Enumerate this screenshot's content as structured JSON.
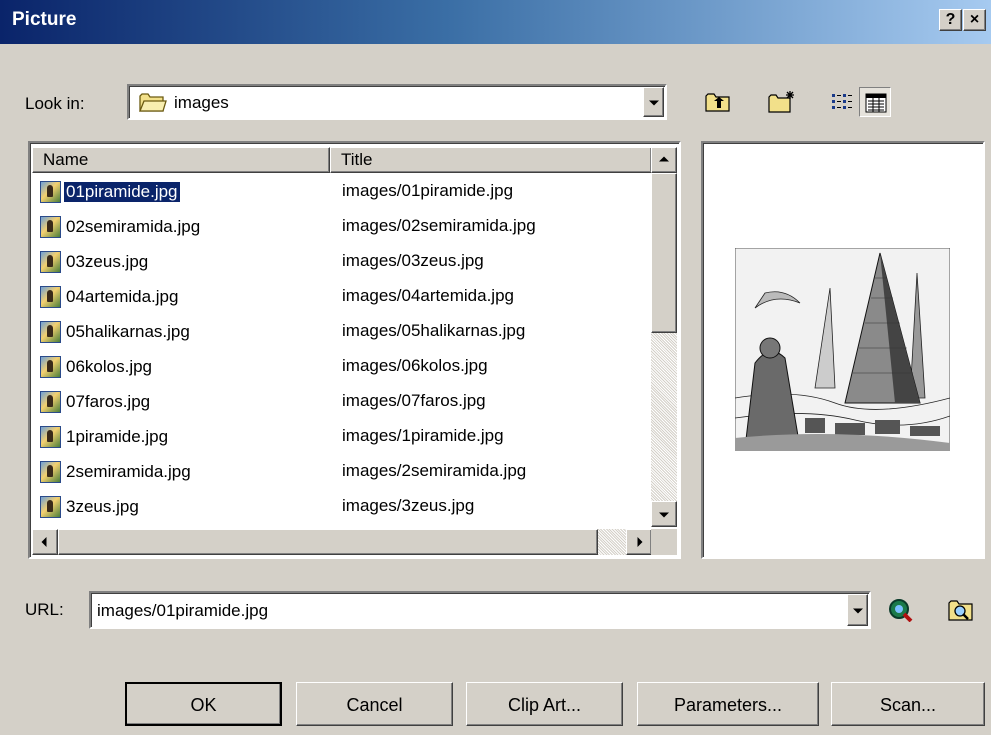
{
  "window": {
    "title": "Picture",
    "help_label": "?",
    "close_label": "×"
  },
  "look_in": {
    "label": "Look in:",
    "value": "images"
  },
  "file_list": {
    "columns": [
      "Name",
      "Title"
    ],
    "rows": [
      {
        "name": "01piramide.jpg",
        "title": "images/01piramide.jpg",
        "selected": true
      },
      {
        "name": "02semiramida.jpg",
        "title": "images/02semiramida.jpg"
      },
      {
        "name": "03zeus.jpg",
        "title": "images/03zeus.jpg"
      },
      {
        "name": "04artemida.jpg",
        "title": "images/04artemida.jpg"
      },
      {
        "name": "05halikarnas.jpg",
        "title": "images/05halikarnas.jpg"
      },
      {
        "name": "06kolos.jpg",
        "title": "images/06kolos.jpg"
      },
      {
        "name": "07faros.jpg",
        "title": "images/07faros.jpg"
      },
      {
        "name": "1piramide.jpg",
        "title": "images/1piramide.jpg"
      },
      {
        "name": "2semiramida.jpg",
        "title": "images/2semiramida.jpg"
      },
      {
        "name": "3zeus.jpg",
        "title": "images/3zeus.jpg"
      }
    ]
  },
  "url": {
    "label": "URL:",
    "value": "images/01piramide.jpg"
  },
  "buttons": {
    "ok": "OK",
    "cancel": "Cancel",
    "clip_art": "Clip Art...",
    "parameters": "Parameters...",
    "scan": "Scan..."
  },
  "colors": {
    "selection": "#0a246a",
    "face": "#d4d0c8"
  }
}
